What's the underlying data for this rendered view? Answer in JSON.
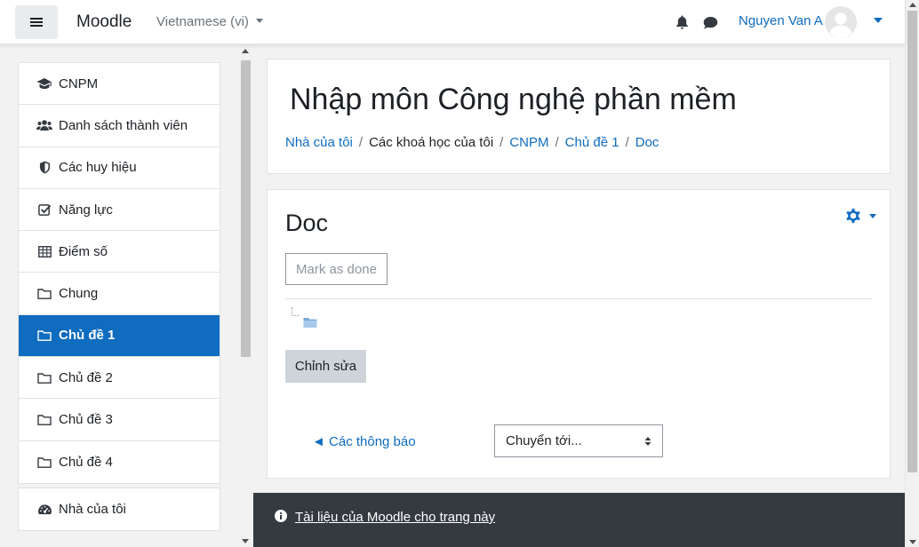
{
  "navbar": {
    "brand": "Moodle",
    "language": "Vietnamese (vi)",
    "user_name": "Nguyen Van A"
  },
  "drawer": {
    "items": [
      {
        "label": "CNPM",
        "icon": "graduation-cap-icon"
      },
      {
        "label": "Danh sách thành viên",
        "icon": "users-icon"
      },
      {
        "label": "Các huy hiệu",
        "icon": "shield-icon"
      },
      {
        "label": "Năng lực",
        "icon": "check-square-icon"
      },
      {
        "label": "Điểm số",
        "icon": "table-icon"
      },
      {
        "label": "Chung",
        "icon": "folder-icon"
      },
      {
        "label": "Chủ đề 1",
        "icon": "folder-icon",
        "active": true
      },
      {
        "label": "Chủ đề 2",
        "icon": "folder-icon"
      },
      {
        "label": "Chủ đề 3",
        "icon": "folder-icon"
      },
      {
        "label": "Chủ đề 4",
        "icon": "folder-icon"
      }
    ],
    "items2": [
      {
        "label": "Nhà của tôi",
        "icon": "dashboard-icon"
      }
    ]
  },
  "header": {
    "title": "Nhập môn Công nghệ phần mềm",
    "breadcrumb": [
      "Nhà của tôi",
      "Các khoá học của tôi",
      "CNPM",
      "Chủ đề 1",
      "Doc"
    ]
  },
  "content": {
    "title": "Doc",
    "mark_done": "Mark as done",
    "edit_button": "Chỉnh sửa",
    "prev_link": "◄ Các thông báo",
    "jump_select": "Chuyển tới..."
  },
  "footer": {
    "docs_link": "Tài liệu của Moodle cho trang này"
  },
  "colors": {
    "primary": "#0f6cbf",
    "footer_bg": "#343a40"
  }
}
